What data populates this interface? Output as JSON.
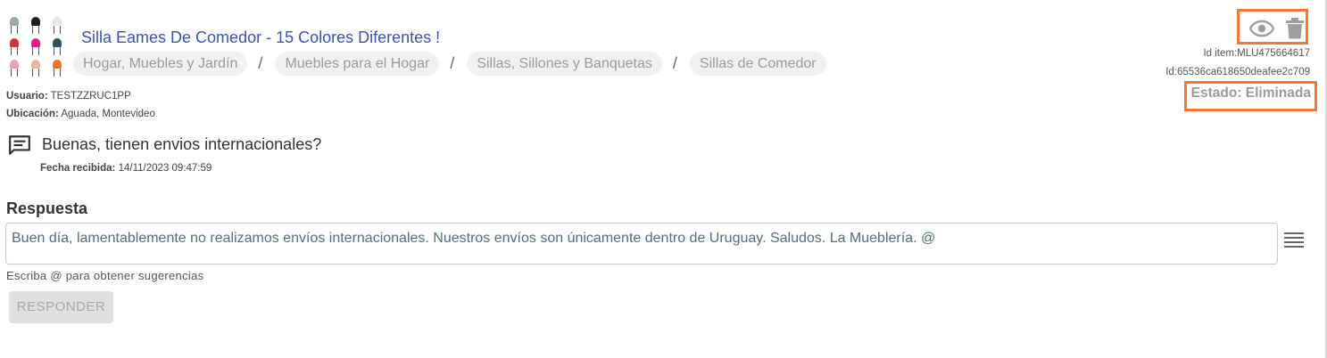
{
  "product": {
    "title": "Silla Eames De Comedor - 15 Colores Diferentes !",
    "thumbnail_colors": [
      "#9aa6ad",
      "#1e1e1e",
      "#e6e6e6",
      "#d8323a",
      "#e01e82",
      "#2c4f5c",
      "#e8a0c0",
      "#e8b8a0",
      "#e8762a"
    ],
    "breadcrumbs": [
      "Hogar, Muebles y Jardín",
      "Muebles para el Hogar",
      "Sillas, Sillones y Banquetas",
      "Sillas de Comedor"
    ],
    "separator": "/"
  },
  "user": {
    "label": "Usuario:",
    "value": "TESTZZRUC1PP"
  },
  "location": {
    "label": "Ubicación:",
    "value": "Aguada, Montevideo"
  },
  "ids": {
    "item": "Id item:MLU475664617",
    "doc": "Id:65536ca618650deafee2c709"
  },
  "status": "Estado: Eliminada",
  "question": {
    "text": "Buenas, tienen envios internacionales?",
    "date_label": "Fecha recibida:",
    "date_value": "14/11/2023 09:47:59"
  },
  "answer": {
    "label": "Respuesta",
    "value": "Buen día, lamentablemente no realizamos envíos internacionales. Nuestros envíos son únicamente dentro de Uruguay. Saludos. La Mueblería. @",
    "hint": "Escriba @ para obtener sugerencias",
    "button": "RESPONDER"
  },
  "icons": {
    "view": "eye-icon",
    "delete": "trash-icon",
    "question": "message-icon",
    "templates": "menu-lines-icon"
  },
  "colors": {
    "accent": "#3f51b5",
    "highlight": "#f07a35",
    "muted": "#9a9a9a"
  }
}
